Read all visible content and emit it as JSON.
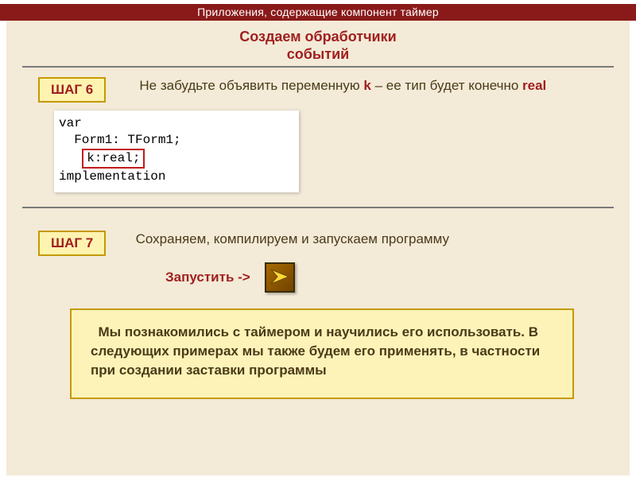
{
  "header": {
    "title": "Приложения, содержащие компонент таймер"
  },
  "section": {
    "title_line1": "Создаем обработчики",
    "title_line2": "событий"
  },
  "step6": {
    "badge": "ШАГ 6",
    "text_before_k": "Не забудьте объявить переменную ",
    "k": "k",
    "text_mid": " – ее тип будет конечно ",
    "real": "real"
  },
  "code": {
    "l1": "var",
    "l2": "  Form1: TForm1;",
    "l3": "k:real;",
    "l4": "implementation"
  },
  "step7": {
    "badge": "ШАГ 7",
    "text": "Сохраняем, компилируем и запускаем программу",
    "run_label": "Запустить ->"
  },
  "summary": {
    "text": "Мы познакомились с таймером и научились его использовать. В следующих примерах мы также будем его применять, в частности при создании заставки программы"
  }
}
